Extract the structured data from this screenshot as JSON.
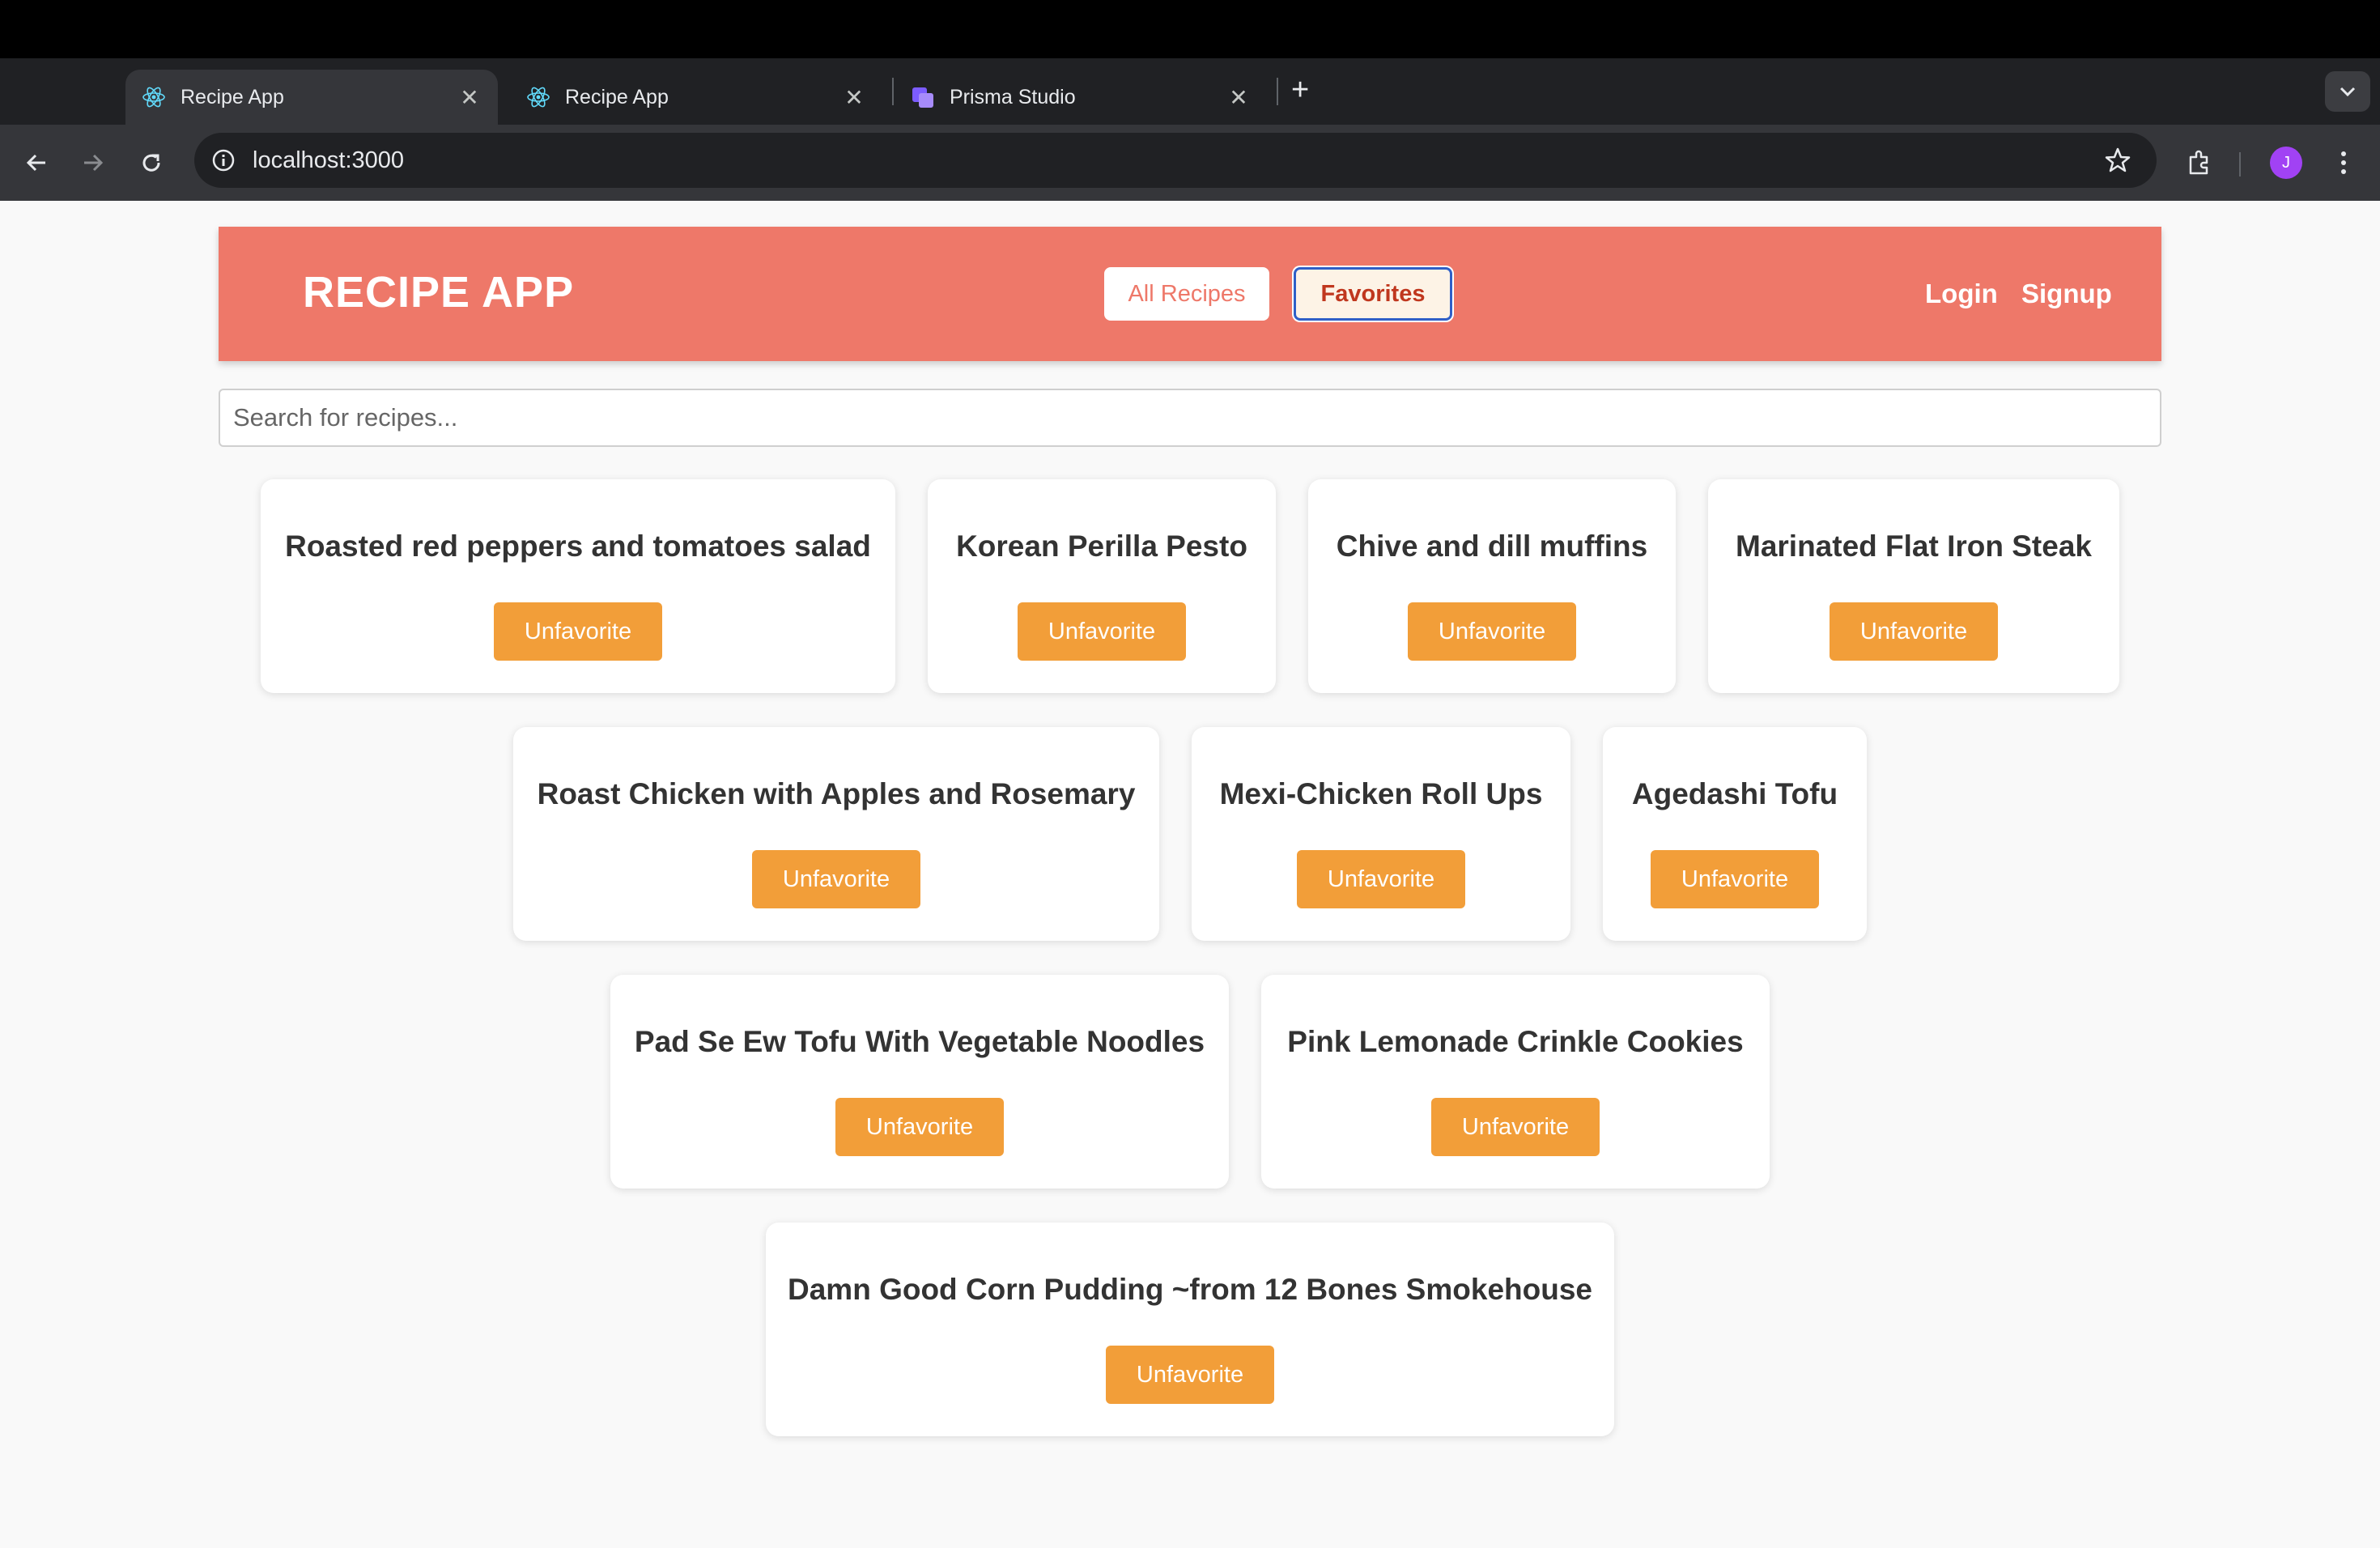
{
  "browser": {
    "tabs": [
      {
        "title": "Recipe App",
        "icon": "react-icon",
        "close": "✕"
      },
      {
        "title": "Recipe App",
        "icon": "react-icon",
        "close": "✕"
      },
      {
        "title": "Prisma Studio",
        "icon": "prisma-icon",
        "close": "✕"
      }
    ],
    "new_tab": "+",
    "url": "localhost:3000",
    "profile_initial": "J",
    "colors": {
      "avatar": "#a142f4"
    }
  },
  "app": {
    "logo": "RECIPE APP",
    "nav": {
      "all_recipes": "All Recipes",
      "favorites": "Favorites",
      "active": "Favorites"
    },
    "auth": {
      "login": "Login",
      "signup": "Signup"
    },
    "search": {
      "placeholder": "Search for recipes...",
      "value": ""
    },
    "colors": {
      "header": "#ee7869",
      "button": "#f29e39"
    },
    "recipes": [
      {
        "title": "Roasted red peppers and tomatoes salad",
        "action": "Unfavorite"
      },
      {
        "title": "Korean Perilla Pesto",
        "action": "Unfavorite"
      },
      {
        "title": "Chive and dill muffins",
        "action": "Unfavorite"
      },
      {
        "title": "Marinated Flat Iron Steak",
        "action": "Unfavorite"
      },
      {
        "title": "Roast Chicken with Apples and Rosemary",
        "action": "Unfavorite"
      },
      {
        "title": "Mexi-Chicken Roll Ups",
        "action": "Unfavorite"
      },
      {
        "title": "Agedashi Tofu",
        "action": "Unfavorite"
      },
      {
        "title": "Pad Se Ew Tofu With Vegetable Noodles",
        "action": "Unfavorite"
      },
      {
        "title": "Pink Lemonade Crinkle Cookies",
        "action": "Unfavorite"
      },
      {
        "title": "Damn Good Corn Pudding ~from 12 Bones Smokehouse",
        "action": "Unfavorite"
      }
    ]
  }
}
